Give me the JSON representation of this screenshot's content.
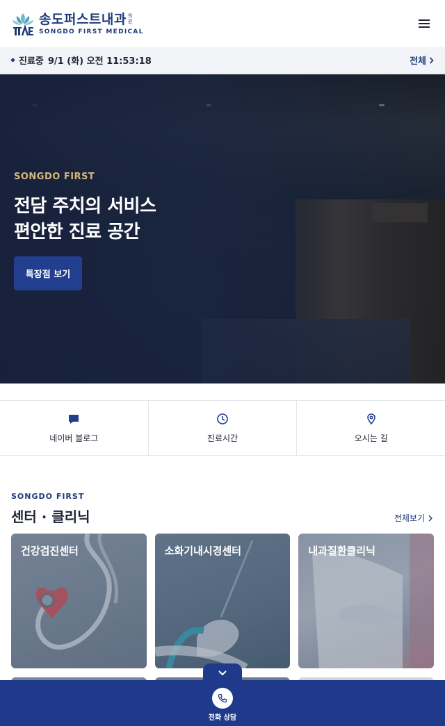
{
  "header": {
    "logo_ko": "송도퍼스트내과",
    "logo_ko_small": "의원",
    "logo_en": "SONGDO FIRST MEDICAL",
    "menu_icon": "hamburger-menu-icon"
  },
  "status": {
    "state": "진료중",
    "datetime": "9/1 (화) 오전 11:53:18",
    "all_label": "전체"
  },
  "hero": {
    "eyebrow": "SONGDO FIRST",
    "title_line1": "전담 주치의 서비스",
    "title_line2": "편안한 진료 공간",
    "button_label": "특장점 보기"
  },
  "quick_menu": [
    {
      "label": "네이버 블로그",
      "icon": "chat-bubble-icon"
    },
    {
      "label": "진료시간",
      "icon": "clock-icon"
    },
    {
      "label": "오시는 길",
      "icon": "map-pin-icon"
    }
  ],
  "section": {
    "eyebrow": "SONGDO FIRST",
    "title": "센터 · 클리닉",
    "more_label": "전체보기"
  },
  "cards": [
    {
      "label": "건강검진센터"
    },
    {
      "label": "소화기내시경센터"
    },
    {
      "label": "내과질환클리닉"
    }
  ],
  "bottom_bar": {
    "call_label": "전화 상담"
  },
  "colors": {
    "brand_navy": "#1f3a8a",
    "accent_gold": "#d9b77a",
    "status_bg": "#f2f4f8"
  }
}
